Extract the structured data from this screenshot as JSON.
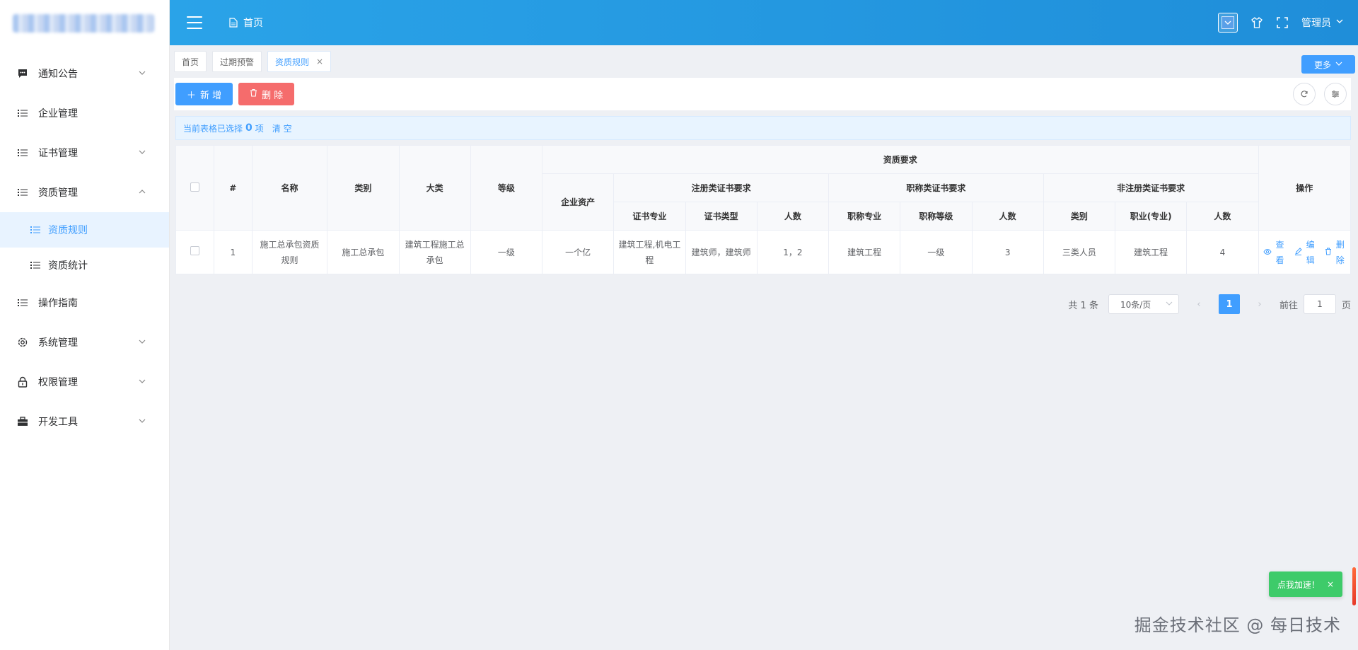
{
  "sidebar": {
    "menu": [
      {
        "label": "通知公告",
        "icon": "message-icon",
        "has_children": true
      },
      {
        "label": "企业管理",
        "icon": "list-icon",
        "has_children": false
      },
      {
        "label": "证书管理",
        "icon": "list-icon",
        "has_children": true
      },
      {
        "label": "资质管理",
        "icon": "list-icon",
        "has_children": true,
        "expanded": true,
        "children": [
          {
            "label": "资质规则",
            "icon": "list-icon",
            "active": true
          },
          {
            "label": "资质统计",
            "icon": "list-icon",
            "active": false
          }
        ]
      },
      {
        "label": "操作指南",
        "icon": "list-icon",
        "has_children": false
      },
      {
        "label": "系统管理",
        "icon": "gear-icon",
        "has_children": true
      },
      {
        "label": "权限管理",
        "icon": "lock-icon",
        "has_children": true
      },
      {
        "label": "开发工具",
        "icon": "briefcase-icon",
        "has_children": true
      }
    ]
  },
  "header": {
    "crumb": "首页",
    "user": "管理员",
    "accent": "#2aa3e8"
  },
  "tabs": [
    {
      "label": "首页",
      "active": false,
      "closable": false
    },
    {
      "label": "过期预警",
      "active": false,
      "closable": false
    },
    {
      "label": "资质规则",
      "active": true,
      "closable": true
    }
  ],
  "more_label": "更多",
  "toolbar": {
    "add_label": "新 增",
    "delete_label": "删 除"
  },
  "selection": {
    "prefix": "当前表格已选择",
    "count": "0",
    "suffix": "项",
    "clear_label": "清 空"
  },
  "table": {
    "headers": {
      "index": "#",
      "name": "名称",
      "category": "类别",
      "major_category": "大类",
      "grade": "等级",
      "qual_req": "资质要求",
      "assets": "企业资产",
      "reg_group": "注册类证书要求",
      "title_group": "职称类证书要求",
      "nonreg_group": "非注册类证书要求",
      "reg_major": "证书专业",
      "reg_type": "证书类型",
      "reg_count": "人数",
      "title_major": "职称专业",
      "title_level": "职称等级",
      "title_count": "人数",
      "nonreg_type": "类别",
      "nonreg_major": "职业(专业)",
      "nonreg_count": "人数",
      "actions": "操作"
    },
    "rows": [
      {
        "index": "1",
        "name": "施工总承包资质规则",
        "category": "施工总承包",
        "major_category": "建筑工程施工总承包",
        "grade": "一级",
        "assets": "一个亿",
        "reg_major": "建筑工程,机电工程",
        "reg_type": "建筑师，建筑师",
        "reg_count": "1，2",
        "title_major": "建筑工程",
        "title_level": "一级",
        "title_count": "3",
        "nonreg_type": "三类人员",
        "nonreg_major": "建筑工程",
        "nonreg_count": "4",
        "view_label": "查看",
        "edit_label": "编辑",
        "delete_label": "删除"
      }
    ]
  },
  "pagination": {
    "total": "共 1 条",
    "page_size": "10条/页",
    "current_page": "1",
    "goto_prefix": "前往",
    "goto_value": "1",
    "goto_suffix": "页"
  },
  "toast": {
    "label": "点我加速！"
  },
  "watermark": "掘金技术社区 @ 每日技术"
}
